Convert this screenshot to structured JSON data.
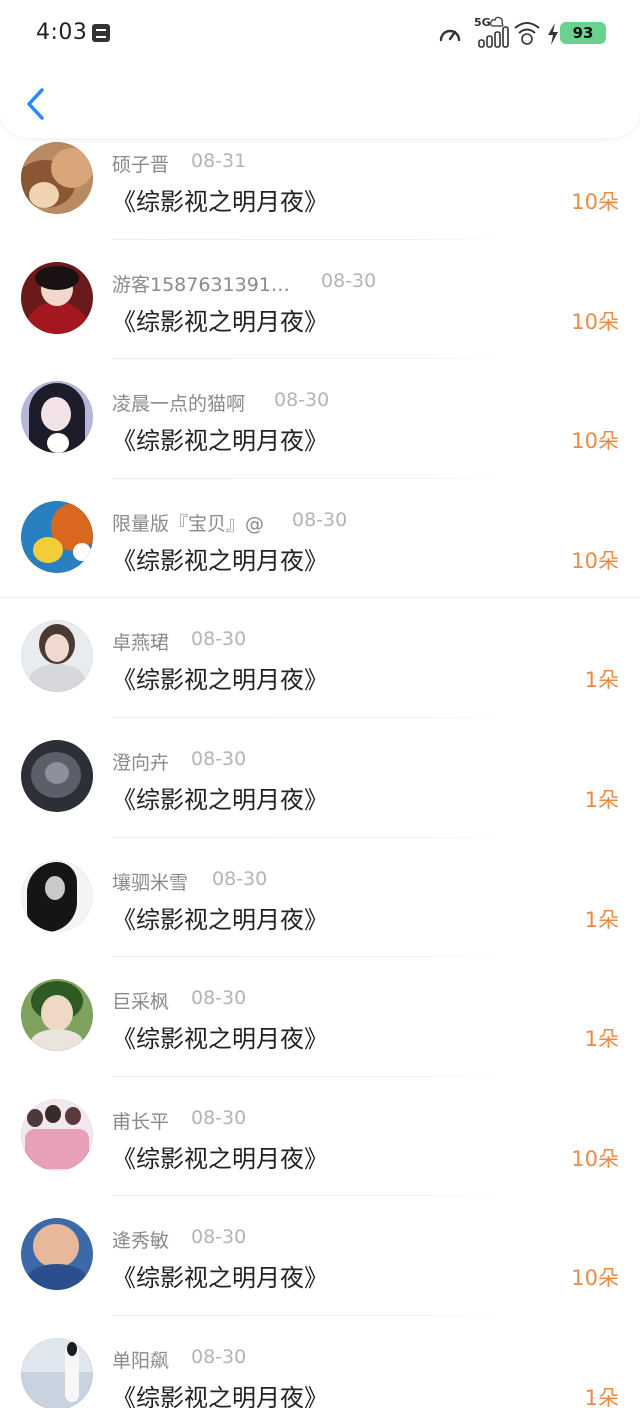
{
  "status_bar": {
    "time": "4:03",
    "network": "5G",
    "battery": "93",
    "icons": [
      "speed-icon",
      "signal-icon",
      "cloud-icon",
      "wifi-icon",
      "charging-icon"
    ]
  },
  "header": {
    "back_icon": "chevron-left-icon",
    "accent_color": "#2b8ef0"
  },
  "colors": {
    "count": "#ec8a44",
    "name": "#8a8a8a",
    "date": "#b4b4b4",
    "title": "#222222"
  },
  "gifts": [
    {
      "name": "硕子晋",
      "date": "08-31",
      "title": "《综影视之明月夜》",
      "count": "10朵"
    },
    {
      "name": "游客1587631391…",
      "date": "08-30",
      "title": "《综影视之明月夜》",
      "count": "10朵"
    },
    {
      "name": "凌晨一点的猫啊",
      "date": "08-30",
      "title": "《综影视之明月夜》",
      "count": "10朵"
    },
    {
      "name": "限量版『宝贝』@",
      "date": "08-30",
      "title": "《综影视之明月夜》",
      "count": "10朵"
    },
    {
      "name": "卓燕珺",
      "date": "08-30",
      "title": "《综影视之明月夜》",
      "count": "1朵"
    },
    {
      "name": "澄向卉",
      "date": "08-30",
      "title": "《综影视之明月夜》",
      "count": "1朵"
    },
    {
      "name": "壤驷米雪",
      "date": "08-30",
      "title": "《综影视之明月夜》",
      "count": "1朵"
    },
    {
      "name": "巨采枫",
      "date": "08-30",
      "title": "《综影视之明月夜》",
      "count": "1朵"
    },
    {
      "name": "甫长平",
      "date": "08-30",
      "title": "《综影视之明月夜》",
      "count": "10朵"
    },
    {
      "name": "逄秀敏",
      "date": "08-30",
      "title": "《综影视之明月夜》",
      "count": "10朵"
    },
    {
      "name": "单阳飙",
      "date": "08-30",
      "title": "《综影视之明月夜》",
      "count": "1朵"
    }
  ]
}
